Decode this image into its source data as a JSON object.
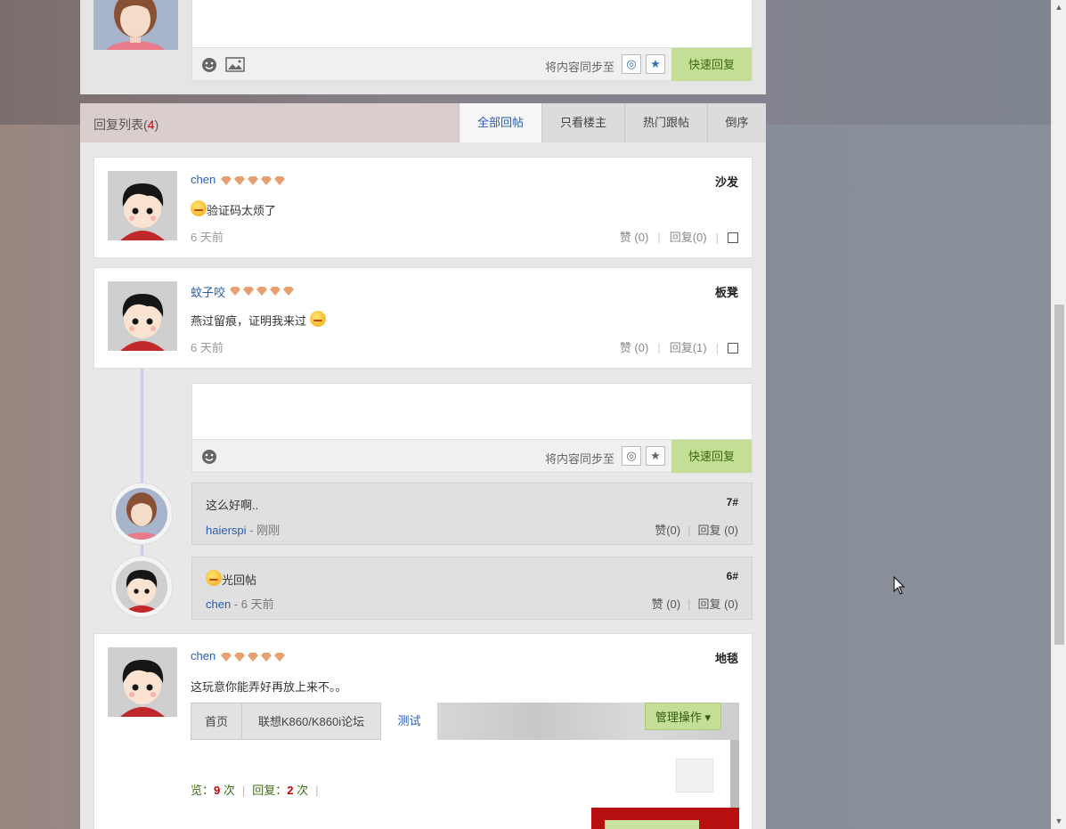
{
  "editor_top": {
    "sync_label": "将内容同步至",
    "quick_reply": "快速回复"
  },
  "reply_list": {
    "title": "回复列表(",
    "count": "4",
    "close": ")",
    "tabs": [
      "全部回帖",
      "只看楼主",
      "热门跟帖",
      "倒序"
    ]
  },
  "posts": [
    {
      "user": "chen",
      "floor": "沙发",
      "content": "验证码太烦了",
      "time": "6 天前",
      "like": "赞 (0)",
      "reply": "回复(0)"
    },
    {
      "user": "蚊子咬",
      "floor": "板凳",
      "content": "燕过留痕，证明我来过",
      "time": "6 天前",
      "like": "赞 (0)",
      "reply": "回复(1)"
    },
    {
      "user": "chen",
      "floor": "地毯",
      "content": "这玩意你能弄好再放上来不。。",
      "time": "",
      "like": "",
      "reply": ""
    }
  ],
  "sub_editor": {
    "sync_label": "将内容同步至",
    "quick_reply": "快速回复"
  },
  "sub_replies": [
    {
      "text": "这么好啊..",
      "user": "haierspi",
      "time": " - 刚刚",
      "no": "7#",
      "like": "赞(0)",
      "reply": "回复 (0)"
    },
    {
      "text": "光回帖",
      "user": "chen",
      "time": " - 6 天前",
      "no": "6#",
      "like": "赞 (0)",
      "reply": "回复 (0)"
    }
  ],
  "embed": {
    "crumbs": [
      "首页",
      "联想K860/K860i论坛",
      "测试"
    ],
    "manage": "管理操作",
    "stats_view_label": "览：",
    "stats_view": "9",
    "stats_view_unit": " 次",
    "stats_reply_label": "回复：",
    "stats_reply": "2",
    "stats_reply_unit": " 次"
  },
  "colors": {
    "accent_green": "#c4de95",
    "link_blue": "#2a5db0",
    "count_red": "#c00"
  }
}
